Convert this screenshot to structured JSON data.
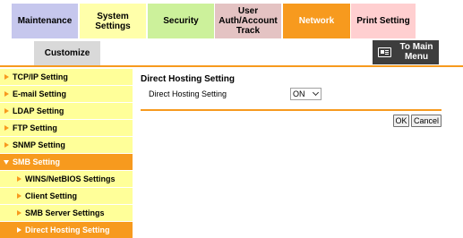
{
  "tabs": {
    "maintenance": "Maintenance",
    "system_settings": "System Settings",
    "security": "Security",
    "user_auth_line1": "User",
    "user_auth_line2": "Auth/Account",
    "user_auth_line3": "Track",
    "network": "Network",
    "print_setting": "Print Setting",
    "customize": "Customize"
  },
  "main_menu": {
    "line1": "To Main",
    "line2": "Menu",
    "icon": "main-menu-icon"
  },
  "sidebar": {
    "items": [
      {
        "label": "TCP/IP Setting"
      },
      {
        "label": "E-mail Setting"
      },
      {
        "label": "LDAP Setting"
      },
      {
        "label": "FTP Setting"
      },
      {
        "label": "SNMP Setting"
      },
      {
        "label": "SMB Setting"
      },
      {
        "label": "WINS/NetBIOS Settings"
      },
      {
        "label": "Client Setting"
      },
      {
        "label": "SMB Server Settings"
      },
      {
        "label": "Direct Hosting Setting"
      }
    ]
  },
  "content": {
    "title": "Direct Hosting Setting",
    "setting_label": "Direct Hosting Setting",
    "setting_value": "ON"
  },
  "buttons": {
    "ok": "OK",
    "cancel": "Cancel"
  },
  "colors": {
    "accent": "#f79a1e",
    "sidebar_bg": "#ffff99"
  }
}
